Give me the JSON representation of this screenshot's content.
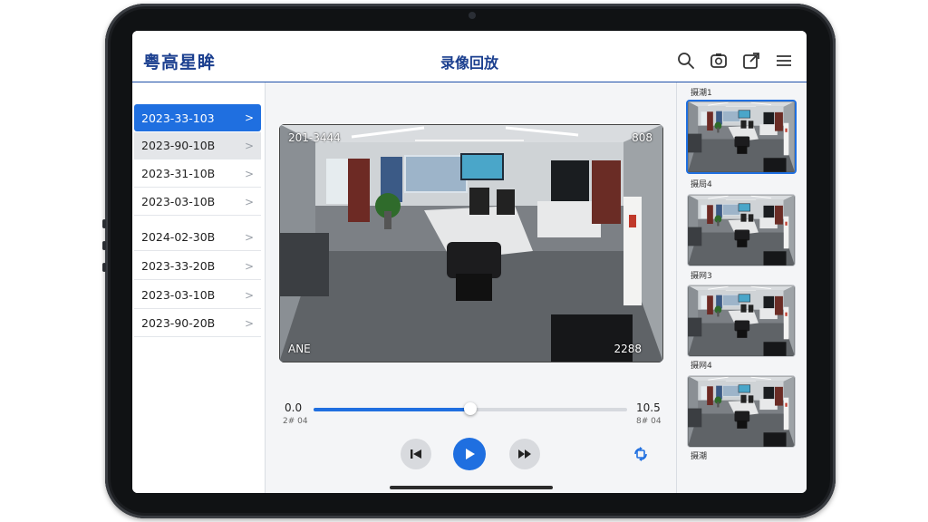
{
  "header": {
    "logo": "粤高星眸",
    "title": "录像回放",
    "icons": [
      "search-icon",
      "snapshot-icon",
      "export-icon",
      "menu-icon"
    ]
  },
  "sidebar": {
    "items": [
      {
        "label": "2023-33-103",
        "state": "active"
      },
      {
        "label": "2023-90-10B",
        "state": "muted"
      },
      {
        "label": "2023-31-10B",
        "state": "normal"
      },
      {
        "label": "2023-03-10B",
        "state": "normal"
      },
      {
        "label": "2024-02-30B",
        "state": "normal"
      },
      {
        "label": "2023-33-20B",
        "state": "normal"
      },
      {
        "label": "2023-03-10B",
        "state": "normal"
      },
      {
        "label": "2023-90-20B",
        "state": "normal"
      }
    ]
  },
  "video": {
    "overlay_top_left": "201-3444",
    "overlay_top_right": "808",
    "overlay_bottom_left": "ANE",
    "overlay_bottom_right": "2288"
  },
  "timeline": {
    "start": "0.0",
    "start_sub": "2# 04",
    "end": "10.5",
    "end_sub": "8# 04",
    "progress": 0.5
  },
  "controls": {
    "icons": [
      "skip-back-icon",
      "play-icon",
      "skip-forward-icon",
      "rotate-icon"
    ]
  },
  "cameras": [
    {
      "label": "摄潮1",
      "selected": true
    },
    {
      "label": "摄局4",
      "selected": false
    },
    {
      "label": "摄网3",
      "selected": false
    },
    {
      "label": "摄网4",
      "selected": false
    },
    {
      "label": "摄潮",
      "selected": false
    }
  ],
  "colors": {
    "accent": "#1f6fe0",
    "brand": "#1b3f8f"
  }
}
